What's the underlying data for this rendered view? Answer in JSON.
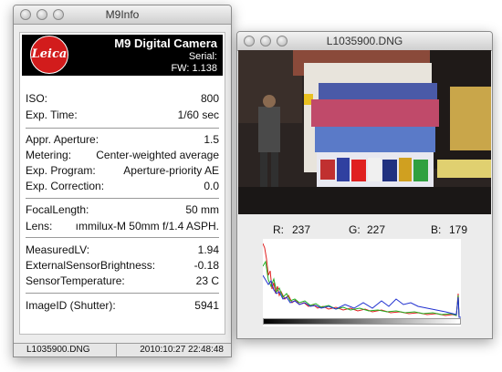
{
  "info_window": {
    "title": "M9Info",
    "logo_text": "Leica",
    "camera": "M9 Digital Camera",
    "serial_label": "Serial:",
    "firmware": "FW: 1.138",
    "rows": [
      {
        "label": "ISO:",
        "value": "800"
      },
      {
        "label": "Exp. Time:",
        "value": "1/60 sec"
      },
      {
        "label": "Appr. Aperture:",
        "value": "1.5"
      },
      {
        "label": "Metering:",
        "value": "Center-weighted average"
      },
      {
        "label": "Exp. Program:",
        "value": "Aperture-priority AE"
      },
      {
        "label": "Exp. Correction:",
        "value": "0.0"
      },
      {
        "label": "FocalLength:",
        "value": "50 mm"
      },
      {
        "label": "Lens:",
        "value": "ımmilux-M 50mm f/1.4 ASPH."
      },
      {
        "label": "MeasuredLV:",
        "value": "1.94"
      },
      {
        "label": "ExternalSensorBrightness:",
        "value": "-0.18"
      },
      {
        "label": "SensorTemperature:",
        "value": "23 C"
      },
      {
        "label": "ImageID (Shutter):",
        "value": "5941"
      }
    ],
    "status_filename": "L1035900.DNG",
    "status_datetime": "2010:10:27 22:48:48"
  },
  "image_window": {
    "title": "L1035900.DNG",
    "r_label": "R:",
    "r_value": "237",
    "g_label": "G:",
    "g_value": "227",
    "b_label": "B:",
    "b_value": "179"
  },
  "colors": {
    "logo_red": "#d21c1c",
    "hist_red": "#e02020",
    "hist_green": "#20b020",
    "hist_blue": "#2030d0"
  },
  "icons": [
    "close-icon",
    "minimize-icon",
    "zoom-icon"
  ]
}
